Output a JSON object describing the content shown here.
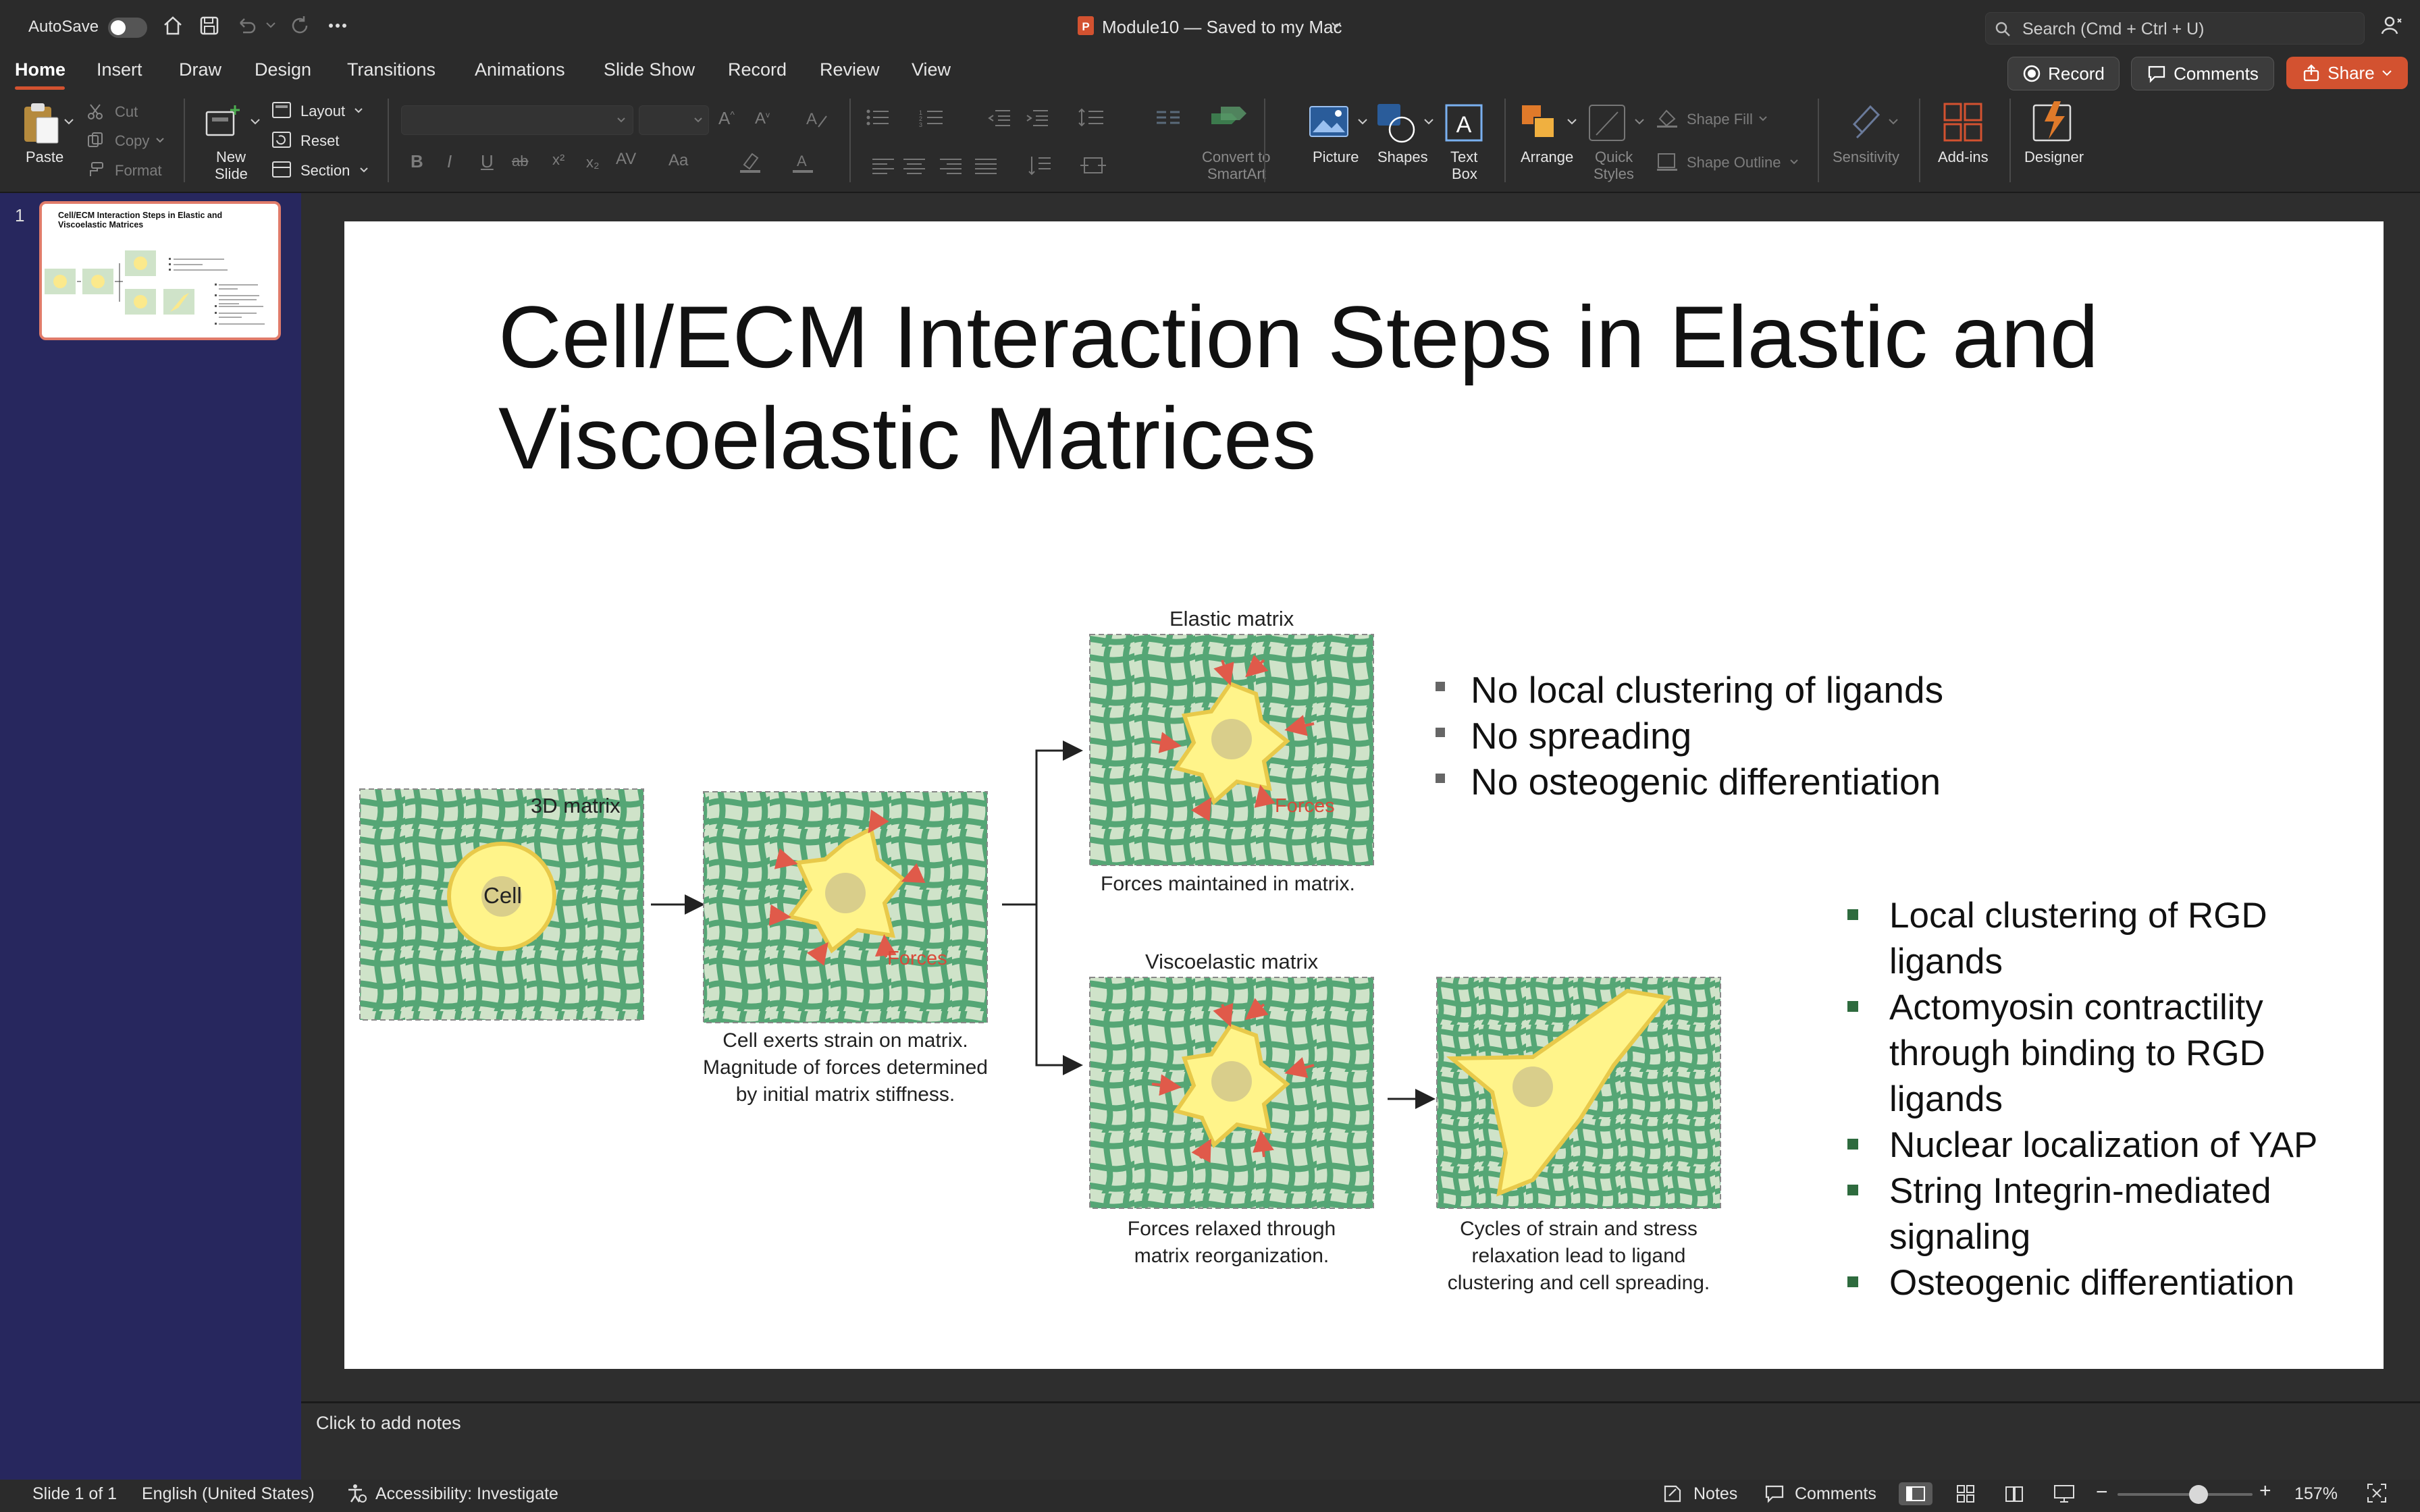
{
  "titlebar": {
    "autosave_label": "AutoSave",
    "doc_title": "Module10 — Saved to my Mac",
    "search_placeholder": "Search (Cmd + Ctrl + U)"
  },
  "tabs": [
    {
      "label": "Home",
      "active": true
    },
    {
      "label": "Insert"
    },
    {
      "label": "Draw"
    },
    {
      "label": "Design"
    },
    {
      "label": "Transitions"
    },
    {
      "label": "Animations"
    },
    {
      "label": "Slide Show"
    },
    {
      "label": "Record"
    },
    {
      "label": "Review"
    },
    {
      "label": "View"
    }
  ],
  "header_buttons": {
    "record": "Record",
    "comments": "Comments",
    "share": "Share"
  },
  "ribbon": {
    "paste": "Paste",
    "cut": "Cut",
    "copy": "Copy",
    "format": "Format",
    "new_slide_1": "New",
    "new_slide_2": "Slide",
    "layout": "Layout",
    "reset": "Reset",
    "section": "Section",
    "convert_1": "Convert to",
    "convert_2": "SmartArt",
    "picture": "Picture",
    "shapes": "Shapes",
    "textbox_1": "Text",
    "textbox_2": "Box",
    "arrange": "Arrange",
    "quick_styles_1": "Quick",
    "quick_styles_2": "Styles",
    "shape_fill": "Shape Fill",
    "shape_outline": "Shape Outline",
    "sensitivity": "Sensitivity",
    "addins": "Add-ins",
    "designer": "Designer",
    "font_buttons": {
      "bold": "B",
      "italic": "I",
      "underline": "U",
      "strike": "ab"
    }
  },
  "thumbnail": {
    "number": "1",
    "title": "Cell/ECM Interaction Steps in Elastic and Viscoelastic Matrices"
  },
  "slide": {
    "title_line1": "Cell/ECM Interaction Steps in Elastic and",
    "title_line2": "Viscoelastic Matrices",
    "elastic_bullets": [
      "No local clustering of ligands",
      "No spreading",
      "No osteogenic differentiation"
    ],
    "viscoelastic_bullets": [
      [
        "Local clustering of RGD",
        "ligands"
      ],
      [
        "Actomyosin contractility",
        "through binding to RGD",
        "ligands"
      ],
      [
        "Nuclear localization of YAP"
      ],
      [
        "String Integrin-mediated",
        "signaling"
      ],
      [
        "Osteogenic differentiation"
      ]
    ],
    "figure": {
      "matrix_label": "3D matrix",
      "cell_label": "Cell",
      "forces_label": "Forces",
      "elastic_header": "Elastic matrix",
      "viscoelastic_header": "Viscoelastic matrix",
      "caption_strain": [
        "Cell exerts strain on matrix.",
        "Magnitude of forces determined",
        "by initial matrix stiffness."
      ],
      "caption_elastic": "Forces maintained in matrix.",
      "caption_relaxed": [
        "Forces relaxed through",
        "matrix reorganization."
      ],
      "caption_cycles": [
        "Cycles of strain and stress",
        "relaxation lead to ligand",
        "clustering and cell spreading."
      ]
    }
  },
  "notes_placeholder": "Click to add notes",
  "statusbar": {
    "slide_count": "Slide 1 of 1",
    "language": "English (United States)",
    "accessibility": "Accessibility: Investigate",
    "notes": "Notes",
    "comments": "Comments",
    "zoom": "157%",
    "zoom_fraction": 0.6
  },
  "colors": {
    "accent": "#d35230",
    "matrix_bg": "#cfe3c9",
    "fiber": "#55a675",
    "cell": "#fbe98c",
    "force": "#e05a4a"
  }
}
